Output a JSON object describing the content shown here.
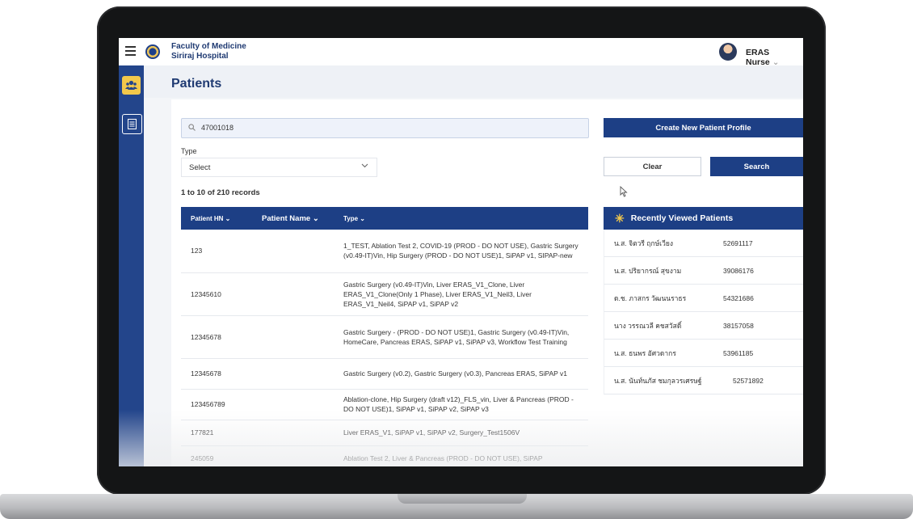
{
  "header": {
    "org_line1": "Faculty of Medicine",
    "org_line2": "Siriraj Hospital",
    "user_name": "ERAS Nurse",
    "user_chevron": "⌄"
  },
  "sidebar": {
    "items": [
      {
        "icon": "users-icon",
        "active": true
      },
      {
        "icon": "document-icon",
        "active": false
      }
    ]
  },
  "page": {
    "title": "Patients"
  },
  "search": {
    "value": "47001018",
    "icon": "search-icon"
  },
  "filter": {
    "type_label": "Type",
    "type_value": "Select"
  },
  "buttons": {
    "create": "Create New Patient Profile",
    "clear": "Clear",
    "search": "Search"
  },
  "records_text": "1 to 10 of 210 records",
  "table": {
    "headers": [
      "Patient HN ⌄",
      "Patient Name ⌄",
      "Type ⌄"
    ],
    "rows": [
      {
        "hn": "123",
        "type": "1_TEST, Ablation Test 2, COVID-19 (PROD - DO NOT USE), Gastric Surgery (v0.49-IT)Vin, Hip Surgery (PROD - DO NOT USE)1, SiPAP v1, SIPAP-new"
      },
      {
        "hn": "12345610",
        "type": "Gastric Surgery (v0.49-IT)Vin, Liver ERAS_V1_Clone, Liver ERAS_V1_Clone(Only 1 Phase), Liver ERAS_V1_Neil3, Liver ERAS_V1_Neil4, SiPAP v1, SiPAP v2"
      },
      {
        "hn": "12345678",
        "type": "Gastric Surgery -  (PROD - DO NOT USE)1, Gastric Surgery (v0.49-IT)Vin, HomeCare, Pancreas ERAS, SiPAP v1, SiPAP v3, Workflow Test Training"
      },
      {
        "hn": "12345678",
        "type": "Gastric Surgery (v0.2), Gastric Surgery (v0.3), Pancreas ERAS, SiPAP v1"
      },
      {
        "hn": "123456789",
        "type": "Ablation-clone, Hip Surgery (draft v12)_FLS_vin, Liver & Pancreas (PROD - DO NOT USE)1, SiPAP v1, SiPAP v2, SiPAP v3"
      },
      {
        "hn": "177821",
        "type": "Liver ERAS_V1, SiPAP v1, SiPAP v2, Surgery_Test1506V"
      },
      {
        "hn": "245059",
        "type": "Ablation Test 2, Liver & Pancreas (PROD - DO NOT USE), SiPAP"
      }
    ]
  },
  "recent": {
    "title": "Recently Viewed Patients",
    "icon": "medical-star-icon",
    "rows": [
      {
        "name": "น.ส. จิตวรี ฤกษ์เวียง",
        "hn": "52691117"
      },
      {
        "name": "น.ส. ปริยากรณ์ สุขงาม",
        "hn": "39086176"
      },
      {
        "name": "ด.ช. ภาสกร วัฒนนราธร",
        "hn": "54321686"
      },
      {
        "name": "นาง วรรณวลี คชสวัสดิ์",
        "hn": "38157058"
      },
      {
        "name": "น.ส. ธนพร อัศวดากร",
        "hn": "53961185"
      },
      {
        "name": "น.ส. นันท์นภัส ชมกุลวรเศรษฐ์",
        "hn": "52571892"
      }
    ]
  },
  "colors": {
    "primary": "#1d3f85",
    "sidebar": "#23458b",
    "active_icon": "#f2c84b"
  }
}
